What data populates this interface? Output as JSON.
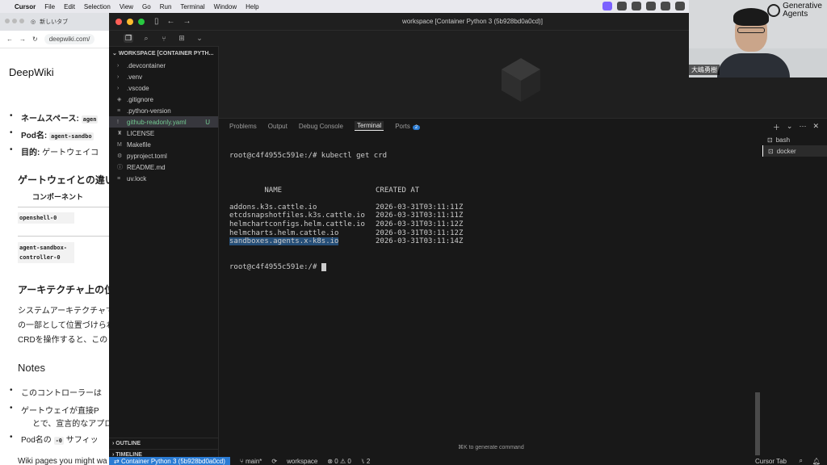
{
  "menubar": {
    "app": "Cursor",
    "items": [
      "File",
      "Edit",
      "Selection",
      "View",
      "Go",
      "Run",
      "Terminal",
      "Window",
      "Help"
    ]
  },
  "browser": {
    "tab_title": "新しいタブ",
    "url": "deepwiki.com/",
    "site_title": "DeepWiki",
    "bullets": [
      {
        "label": "ネームスペース:",
        "code": "agen"
      },
      {
        "label": "Pod名:",
        "code": "agent-sandbo"
      },
      {
        "label": "目的:",
        "text": "ゲートウェイコ"
      }
    ],
    "heading1": "ゲートウェイとの違い",
    "table_header": "コンポーネント",
    "cell1": "openshell-0",
    "cell2": "agent-sandbox-controller-0",
    "heading2": "アーキテクチャ上の位",
    "para1": "システムアーキテクチャで",
    "para2": "の一部として位置づけられ",
    "para3": "CRDを操作すると、この",
    "heading3": "Notes",
    "note1": "このコントローラーは",
    "note2a": "ゲートウェイが直接P",
    "note2b": "とで、宣言的なアプロ",
    "note3_prefix": "Pod名の",
    "note3_code": "-0",
    "note3_suffix": "サフィッ",
    "footer": "Wiki pages you might wa"
  },
  "window": {
    "title": "workspace [Container Python 3 (5b928bd0a0cd)]"
  },
  "sidebar": {
    "workspace_header": "WORKSPACE [CONTAINER PYTH...",
    "files": [
      {
        "icon": "chevron-right",
        "name": ".devcontainer",
        "type": "folder"
      },
      {
        "icon": "chevron-right",
        "name": ".venv",
        "type": "folder"
      },
      {
        "icon": "chevron-right",
        "name": ".vscode",
        "type": "folder"
      },
      {
        "icon": "git",
        "name": ".gitignore",
        "type": "file"
      },
      {
        "icon": "lines",
        "name": ".python-version",
        "type": "file"
      },
      {
        "icon": "exclam",
        "name": "github-readonly.yaml",
        "type": "file",
        "badge": "U",
        "selected": true
      },
      {
        "icon": "person",
        "name": "LICENSE",
        "type": "file"
      },
      {
        "icon": "make",
        "name": "Makefile",
        "type": "file"
      },
      {
        "icon": "gear",
        "name": "pyproject.toml",
        "type": "file"
      },
      {
        "icon": "info",
        "name": "README.md",
        "type": "file"
      },
      {
        "icon": "lines",
        "name": "uv.lock",
        "type": "file"
      }
    ],
    "outline": "OUTLINE",
    "timeline": "TIMELINE"
  },
  "panel": {
    "tabs": [
      "Problems",
      "Output",
      "Debug Console",
      "Terminal",
      "Ports"
    ],
    "active_tab": "Terminal",
    "ports_count": "2"
  },
  "terminal": {
    "command_line": "root@c4f4955c591e:/# kubectl get crd",
    "header": {
      "name": "NAME",
      "created": "CREATED AT"
    },
    "rows": [
      {
        "name": "addons.k3s.cattle.io",
        "created": "2026-03-31T03:11:11Z"
      },
      {
        "name": "etcdsnapshotfiles.k3s.cattle.io",
        "created": "2026-03-31T03:11:11Z"
      },
      {
        "name": "helmchartconfigs.helm.cattle.io",
        "created": "2026-03-31T03:11:12Z"
      },
      {
        "name": "helmcharts.helm.cattle.io",
        "created": "2026-03-31T03:11:12Z"
      },
      {
        "name": "sandboxes.agents.x-k8s.io",
        "created": "2026-03-31T03:11:14Z",
        "highlighted": true
      }
    ],
    "prompt": "root@c4f4955c591e:/# ",
    "hint": "⌘K to generate command"
  },
  "terminal_list": [
    "bash",
    "docker"
  ],
  "statusbar": {
    "remote": "Container Python 3 (5b928bd0a0cd)",
    "branch": "main*",
    "workspace": "workspace",
    "errors": "0",
    "warnings": "0",
    "ports": "2",
    "cursor_tab": "Cursor Tab"
  },
  "webcam": {
    "name": "大嶋勇樹",
    "brand_line1": "Generative",
    "brand_line2": "Agents"
  },
  "colors": {
    "accent": "#2a7bd3",
    "selection": "#264f78",
    "git_untracked": "#73c991"
  }
}
